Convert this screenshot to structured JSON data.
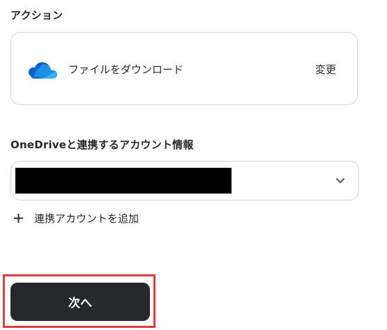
{
  "action": {
    "section_label": "アクション",
    "name": "ファイルをダウンロード",
    "change_label": "変更",
    "icon": "onedrive-cloud-icon"
  },
  "account": {
    "section_label": "OneDriveと連携するアカウント情報",
    "selected_value": "",
    "add_account_label": "連携アカウントを追加"
  },
  "footer": {
    "next_label": "次へ"
  },
  "colors": {
    "text": "#26282c",
    "border": "#d3d5d9",
    "button_bg": "#26282c",
    "highlight": "#e53a3a",
    "onedrive_blue": "#0f78d4"
  }
}
